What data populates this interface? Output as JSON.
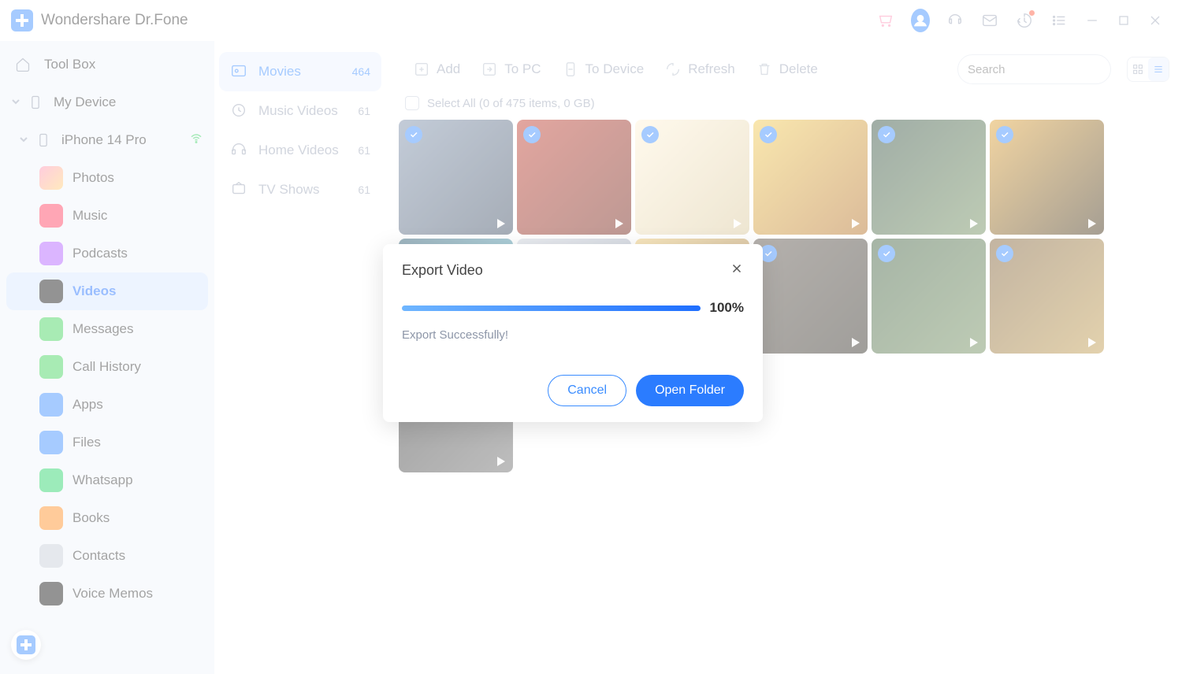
{
  "app": {
    "title": "Wondershare Dr.Fone"
  },
  "sidebar": {
    "toolbox": "Tool Box",
    "mydevice": "My Device",
    "device": "iPhone 14 Pro",
    "items": [
      {
        "label": "Photos",
        "color": "#ff5fa2",
        "bg": "linear-gradient(135deg,#ff8fb5,#ffcf6e)"
      },
      {
        "label": "Music",
        "color": "#ff3b5c",
        "bg": "#ff3b5c"
      },
      {
        "label": "Podcasts",
        "color": "#b05cff",
        "bg": "#b05cff"
      },
      {
        "label": "Videos",
        "color": "#111",
        "bg": "#111"
      },
      {
        "label": "Messages",
        "color": "#3fd35a",
        "bg": "#3fd35a"
      },
      {
        "label": "Call History",
        "color": "#3fd35a",
        "bg": "#3fd35a"
      },
      {
        "label": "Apps",
        "color": "#3a8cff",
        "bg": "#3a8cff"
      },
      {
        "label": "Files",
        "color": "#3a8cff",
        "bg": "#3a8cff"
      },
      {
        "label": "Whatsapp",
        "color": "#25d366",
        "bg": "#25d366"
      },
      {
        "label": "Books",
        "color": "#ff8c1f",
        "bg": "#ff8c1f"
      },
      {
        "label": "Contacts",
        "color": "#8d96a8",
        "bg": "#c6ccd8"
      },
      {
        "label": "Voice Memos",
        "color": "#111",
        "bg": "#111"
      }
    ],
    "selected_index": 3
  },
  "categories": [
    {
      "label": "Movies",
      "count": "464",
      "active": true
    },
    {
      "label": "Music Videos",
      "count": "61",
      "active": false
    },
    {
      "label": "Home Videos",
      "count": "61",
      "active": false
    },
    {
      "label": "TV Shows",
      "count": "61",
      "active": false
    }
  ],
  "toolbar": {
    "add": "Add",
    "topc": "To PC",
    "todev": "To Device",
    "refresh": "Refresh",
    "delete": "Delete",
    "search_placeholder": "Search"
  },
  "selectall": {
    "text": "Select All (0 of 475 items, 0 GB)"
  },
  "tiles": [
    {
      "bg": "linear-gradient(135deg,#7a8da8,#3a4a60)",
      "checked": true
    },
    {
      "bg": "linear-gradient(135deg,#c0392b,#6e1e12)",
      "checked": true
    },
    {
      "bg": "linear-gradient(135deg,#fff2d6,#d9c79a)",
      "checked": true
    },
    {
      "bg": "linear-gradient(135deg,#f2c94c,#b06a1f)",
      "checked": true
    },
    {
      "bg": "linear-gradient(135deg,#2d4a3a,#6e8c5a)",
      "checked": true
    },
    {
      "bg": "linear-gradient(135deg,#e0a030,#3a2a10)",
      "checked": true
    },
    {
      "bg": "linear-gradient(135deg,#2a5c74,#60c5d8)",
      "checked": true
    },
    {
      "bg": "linear-gradient(135deg,#d0d6e0,#8a97ad)",
      "checked": false
    },
    {
      "bg": "linear-gradient(135deg,#f0c96e,#8a5a1f)",
      "checked": false
    },
    {
      "bg": "linear-gradient(135deg,#5a5148,#2d2921)",
      "checked": true
    },
    {
      "bg": "linear-gradient(135deg,#3a5a3a,#6e8c5a)",
      "checked": true
    },
    {
      "bg": "linear-gradient(135deg,#7a5a30,#c09a4a)",
      "checked": true
    },
    {
      "bg": "linear-gradient(135deg,#2a2a2a,#6e6e6e)",
      "checked": true
    }
  ],
  "dialog": {
    "title": "Export Video",
    "percent": "100%",
    "message": "Export Successfully!",
    "cancel": "Cancel",
    "open": "Open Folder"
  }
}
